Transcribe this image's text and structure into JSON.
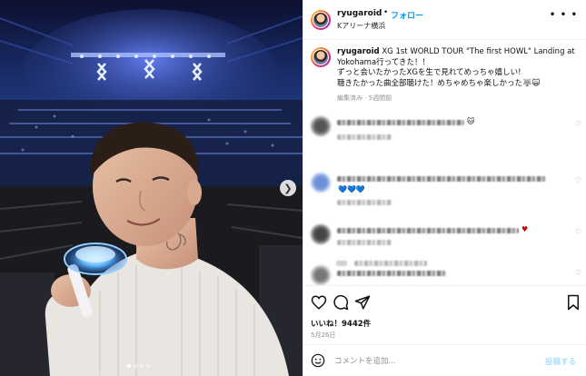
{
  "header": {
    "username": "ryugaroid",
    "separator": "•",
    "follow_label": "フォロー",
    "location": "Kアリーナ横浜",
    "more_icon": "ellipsis-icon"
  },
  "caption": {
    "username": "ryugaroid",
    "text_line1": " XG 1st WORLD TOUR \"The first HOWL\" Landing at Yokohama行ってきた！！",
    "text_line2": "ずっと会いたかったXGを生で見れてめっちゃ嬉しい!",
    "text_line3": "聴きたかった曲全部聴けた！めちゃめちゃ楽しかった🐺🙀",
    "meta": "編集済み · 5週間前"
  },
  "media": {
    "next_icon": "chevron-right-icon",
    "slide_count": 4,
    "active_slide": 1
  },
  "actions": {
    "likes": "いいね！9442件",
    "date": "5月26日",
    "icons": [
      "heart-icon",
      "comment-icon",
      "share-icon",
      "bookmark-icon"
    ]
  },
  "composer": {
    "placeholder": "コメントを追加...",
    "post_label": "投稿する",
    "emoji_icon": "smiley-icon"
  }
}
